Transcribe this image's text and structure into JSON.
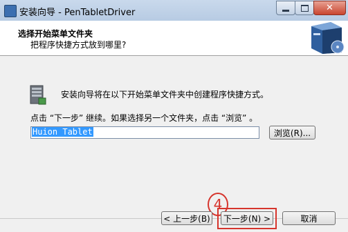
{
  "window": {
    "title": "安装向导 - PenTabletDriver"
  },
  "header": {
    "title": "选择开始菜单文件夹",
    "subtitle": "把程序快捷方式放到哪里?"
  },
  "main": {
    "intro": "安装向导将在以下开始菜单文件夹中创建程序快捷方式。",
    "instruction": "点击 “下一步” 继续。如果选择另一个文件夹，点击 “浏览” 。",
    "folder_value": "Huion Tablet",
    "browse_label": "浏览(R)..."
  },
  "footer": {
    "back_label": "< 上一步(B)",
    "next_label": "下一步(N) >",
    "cancel_label": "取消"
  },
  "annotation": {
    "step_number": "4",
    "color": "#d6342c"
  },
  "icons": [
    "app-icon",
    "minimize-icon",
    "maximize-icon",
    "close-icon",
    "product-box-image",
    "start-menu-folder-icon"
  ]
}
